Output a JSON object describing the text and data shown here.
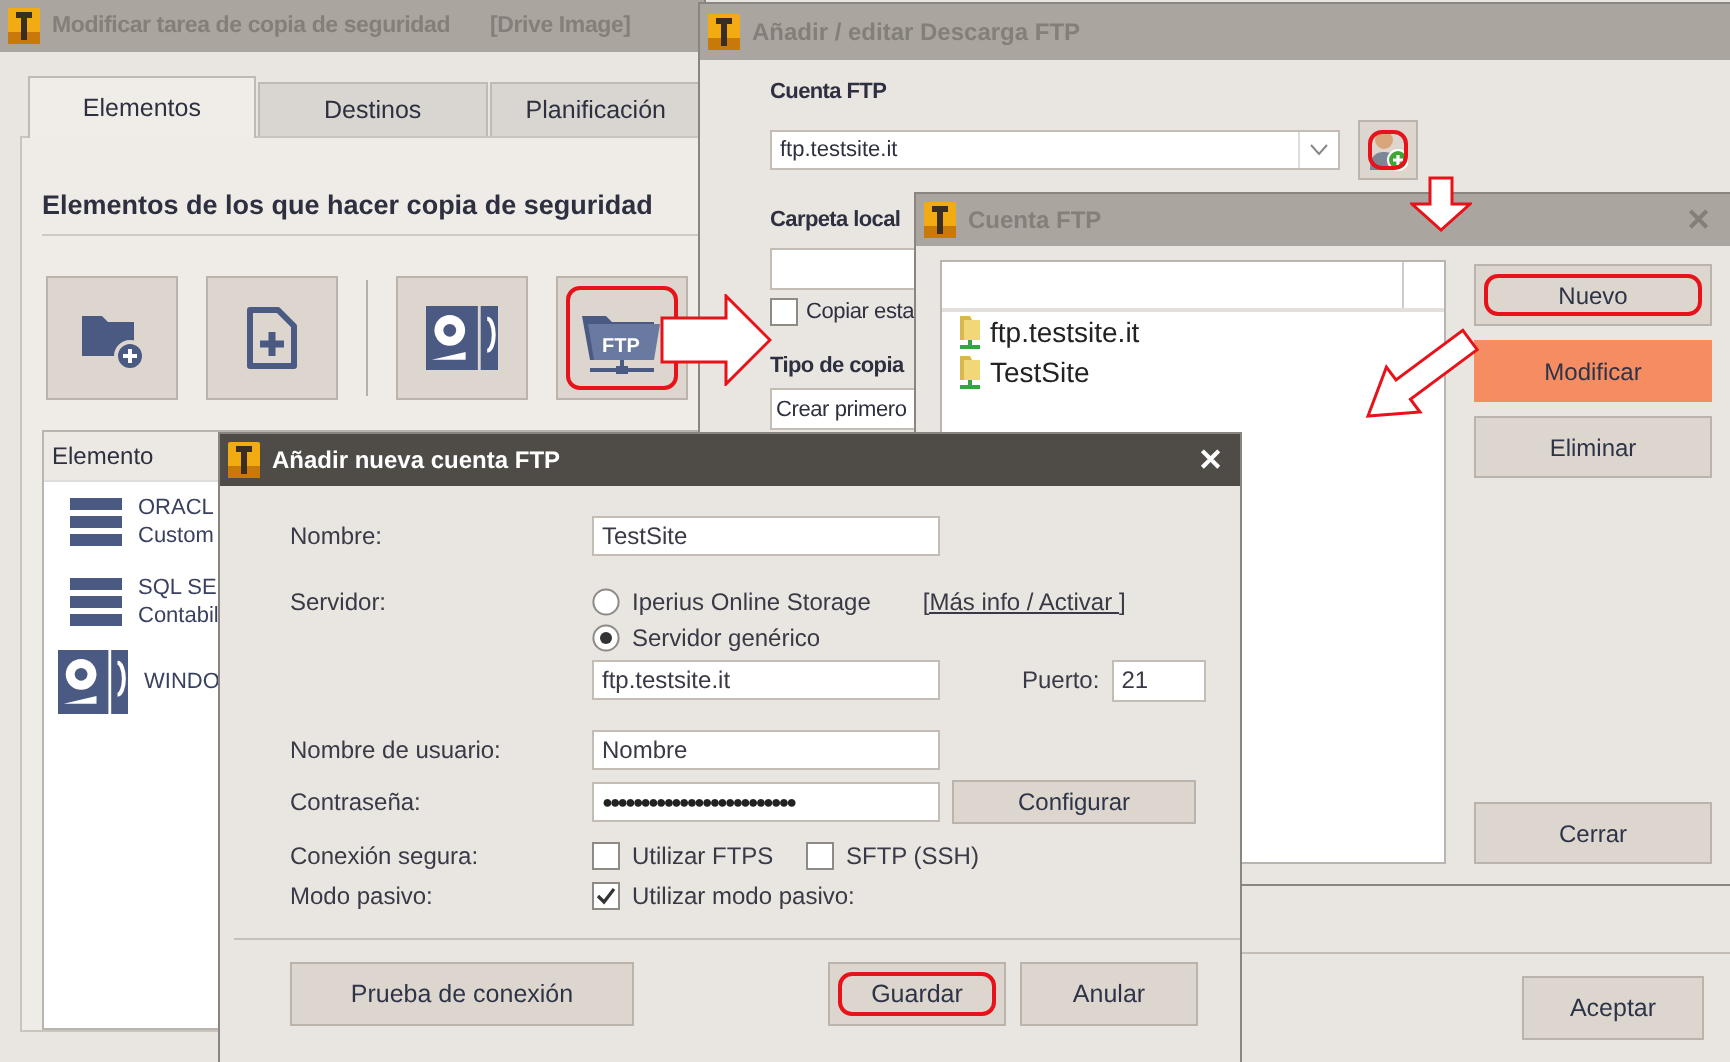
{
  "backup_task_window": {
    "title": "Modificar tarea de copia de seguridad",
    "subtitle": "[Drive Image]",
    "active": false,
    "tabs": [
      {
        "label": "Elementos",
        "selected": true
      },
      {
        "label": "Destinos",
        "selected": false
      },
      {
        "label": "Planificación",
        "selected": false
      }
    ],
    "section_title": "Elementos de los que hacer copia de seguridad",
    "tool_buttons": [
      {
        "kind": "folder-add",
        "highlighted": false
      },
      {
        "kind": "file-add",
        "highlighted": false
      },
      {
        "kind": "disk-image",
        "highlighted": false
      },
      {
        "kind": "ftp",
        "label": "FTP",
        "highlighted": true
      }
    ],
    "list": {
      "column": "Elemento",
      "rows": [
        {
          "kind": "database",
          "lines": [
            "ORACL",
            "Custom"
          ]
        },
        {
          "kind": "database",
          "lines": [
            "SQL SE",
            "Contabil"
          ]
        },
        {
          "kind": "disk-image",
          "lines": [
            "WINDO"
          ]
        }
      ]
    }
  },
  "ftp_download_window": {
    "title": "Añadir / editar Descarga FTP",
    "active": false,
    "account_label": "Cuenta FTP",
    "account_value": "ftp.testsite.it",
    "add_account_highlighted": true,
    "local_folder_label": "Carpeta local",
    "copy_checkbox": {
      "label": "Copiar esta",
      "checked": false
    },
    "copy_type_label": "Tipo de copia",
    "copy_type_value": "Crear primero",
    "buttons": [
      {
        "label": "Aceptar"
      }
    ]
  },
  "ftp_accounts_window": {
    "title": "Cuenta FTP",
    "active": false,
    "close": "✕",
    "accounts": [
      {
        "name": "ftp.testsite.it"
      },
      {
        "name": "TestSite"
      }
    ],
    "buttons": [
      {
        "label": "Nuevo",
        "highlighted": true,
        "hovered": false
      },
      {
        "label": "Modificar",
        "highlighted": false,
        "hovered": true
      },
      {
        "label": "Eliminar",
        "highlighted": false,
        "hovered": false
      },
      {
        "label": "Cerrar",
        "highlighted": false,
        "hovered": false
      }
    ]
  },
  "new_account_dialog": {
    "title": "Añadir nueva cuenta FTP",
    "active": true,
    "close": "✕",
    "name_label": "Nombre:",
    "name_value": "TestSite",
    "server_label": "Servidor:",
    "server_options": [
      {
        "label": "Iperius Online Storage",
        "selected": false
      },
      {
        "label": "Servidor genérico",
        "selected": true
      }
    ],
    "info_link": "[Más info / Activar ]",
    "server_value": "ftp.testsite.it",
    "port_label": "Puerto:",
    "port_value": "21",
    "user_label": "Nombre de usuario:",
    "user_value": "Nombre",
    "password_label": "Contraseña:",
    "password_value": "●●●●●●●●●●●●●●●●●●●●●●●●●",
    "configure_button": "Configurar",
    "secure_label": "Conexión segura:",
    "secure_options": [
      {
        "label": "Utilizar FTPS",
        "checked": false
      },
      {
        "label": "SFTP (SSH)",
        "checked": false
      }
    ],
    "passive_label": "Modo pasivo:",
    "passive_option": {
      "label": "Utilizar modo pasivo:",
      "checked": true
    },
    "buttons": [
      {
        "label": "Prueba de conexión",
        "highlighted": false
      },
      {
        "label": "Guardar",
        "highlighted": true
      },
      {
        "label": "Anular",
        "highlighted": false
      }
    ]
  }
}
